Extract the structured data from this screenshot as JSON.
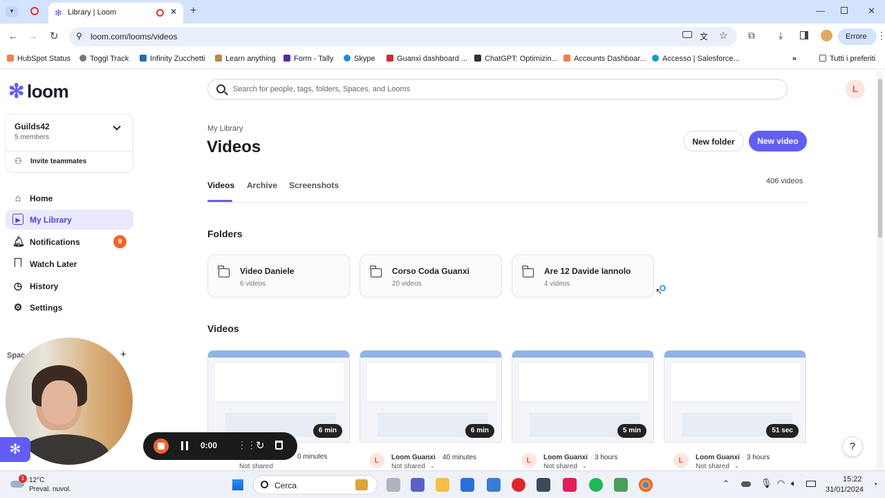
{
  "browser": {
    "tab_title": "Library | Loom",
    "url": "loom.com/looms/videos",
    "profile_status": "Errore",
    "bookmarks": [
      "HubSpot Status",
      "Toggl Track",
      "Infinity Zucchetti",
      "Learn anything",
      "Form - Tally",
      "Skype",
      "Guanxi dashboard ...",
      "ChatGPT: Optimizin...",
      "Accounts Dashboar...",
      "Accesso | Salesforce..."
    ],
    "bookmarks_more": "»",
    "bookmarks_folder": "Tutti i preferiti"
  },
  "sidebar": {
    "logo": "loom",
    "workspace": {
      "name": "Guilds42",
      "members": "5 members",
      "invite": "Invite teammates"
    },
    "nav": [
      {
        "label": "Home",
        "icon": "home-icon"
      },
      {
        "label": "My Library",
        "icon": "library-icon"
      },
      {
        "label": "Notifications",
        "icon": "bell-icon",
        "badge": "9"
      },
      {
        "label": "Watch Later",
        "icon": "bookmark-icon"
      },
      {
        "label": "History",
        "icon": "clock-icon"
      },
      {
        "label": "Settings",
        "icon": "gear-icon"
      }
    ],
    "spaces_label": "Spac",
    "add_label": "+"
  },
  "main": {
    "search_placeholder": "Search for people, tags, folders, Spaces, and Looms",
    "avatar_initial": "L",
    "breadcrumb": "My Library",
    "title": "Videos",
    "new_folder": "New folder",
    "new_video": "New video",
    "tabs": [
      "Videos",
      "Archive",
      "Screenshots"
    ],
    "video_count": "406 videos",
    "folders_heading": "Folders",
    "folders": [
      {
        "name": "Video Daniele",
        "count": "6 videos"
      },
      {
        "name": "Corso Coda Guanxi",
        "count": "20 videos"
      },
      {
        "name": "Are 12 Davide Iannolo",
        "count": "4 videos"
      }
    ],
    "videos_heading": "Videos",
    "videos": [
      {
        "duration": "6 min",
        "owner": "",
        "time": "0 minutes",
        "shared": "Not shared"
      },
      {
        "duration": "6 min",
        "owner": "Loom Guanxi",
        "time": "40 minutes",
        "shared": "Not shared"
      },
      {
        "duration": "5 min",
        "owner": "Loom Guanxi",
        "time": "3 hours",
        "shared": "Not shared"
      },
      {
        "duration": "51 sec",
        "owner": "Loom Guanxi",
        "time": "3 hours",
        "shared": "Not shared"
      }
    ],
    "help": "?"
  },
  "recorder": {
    "timer": "0:00"
  },
  "taskbar": {
    "weather_badge": "1",
    "temperature": "12°C",
    "weather_desc": "Preval. nuvol.",
    "search": "Cerca",
    "time": "15:22",
    "date": "31/01/2024"
  },
  "colors": {
    "accent": "#625df5",
    "badge": "#f4622c",
    "chrome_tabbar": "#d3e3fd"
  }
}
